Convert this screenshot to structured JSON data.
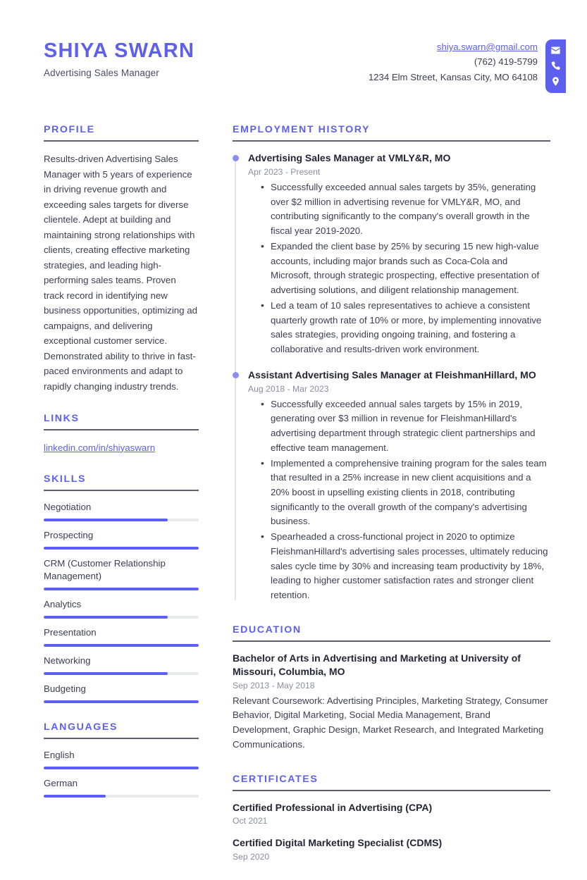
{
  "accent_color": "#5d5fef",
  "rule_color": "#5a6070",
  "header": {
    "full_name": "SHIYA SWARN",
    "job_title": "Advertising Sales Manager",
    "contact": {
      "email": "shiya.swarn@gmail.com",
      "phone": "(762) 419-5799",
      "address": "1234 Elm Street, Kansas City, MO 64108",
      "icons": [
        "envelope-icon",
        "phone-icon",
        "location-pin-icon"
      ]
    }
  },
  "profile": {
    "heading": "PROFILE",
    "text": "Results-driven Advertising Sales Manager with 5 years of experience in driving revenue growth and exceeding sales targets for diverse clientele. Adept at building and maintaining strong relationships with clients, creating effective marketing strategies, and leading high-performing sales teams. Proven track record in identifying new business opportunities, optimizing ad campaigns, and delivering exceptional customer service. Demonstrated ability to thrive in fast-paced environments and adapt to rapidly changing industry trends."
  },
  "links": {
    "heading": "LINKS",
    "items": [
      {
        "label": "linkedin.com/in/shiyaswarn"
      }
    ]
  },
  "skills": {
    "heading": "SKILLS",
    "items": [
      {
        "label": "Negotiation",
        "level": 80
      },
      {
        "label": "Prospecting",
        "level": 100
      },
      {
        "label": "CRM (Customer Relationship Management)",
        "level": 100
      },
      {
        "label": "Analytics",
        "level": 80
      },
      {
        "label": "Presentation",
        "level": 100
      },
      {
        "label": "Networking",
        "level": 80
      },
      {
        "label": "Budgeting",
        "level": 100
      }
    ]
  },
  "languages": {
    "heading": "LANGUAGES",
    "items": [
      {
        "label": "English",
        "level": 100
      },
      {
        "label": "German",
        "level": 40
      }
    ]
  },
  "employment": {
    "heading": "EMPLOYMENT HISTORY",
    "jobs": [
      {
        "title": "Advertising Sales Manager at VMLY&R, MO",
        "date": "Apr 2023 - Present",
        "bullets": [
          "Successfully exceeded annual sales targets by 35%, generating over $2 million in advertising revenue for VMLY&R, MO, and contributing significantly to the company's overall growth in the fiscal year 2019-2020.",
          "Expanded the client base by 25% by securing 15 new high-value accounts, including major brands such as Coca-Cola and Microsoft, through strategic prospecting, effective presentation of advertising solutions, and diligent relationship management.",
          "Led a team of 10 sales representatives to achieve a consistent quarterly growth rate of 10% or more, by implementing innovative sales strategies, providing ongoing training, and fostering a collaborative and results-driven work environment."
        ]
      },
      {
        "title": "Assistant Advertising Sales Manager at FleishmanHillard, MO",
        "date": "Aug 2018 - Mar 2023",
        "bullets": [
          "Successfully exceeded annual sales targets by 15% in 2019, generating over $3 million in revenue for FleishmanHillard's advertising department through strategic client partnerships and effective team management.",
          "Implemented a comprehensive training program for the sales team that resulted in a 25% increase in new client acquisitions and a 20% boost in upselling existing clients in 2018, contributing significantly to the overall growth of the company's advertising business.",
          "Spearheaded a cross-functional project in 2020 to optimize FleishmanHillard's advertising sales processes, ultimately reducing sales cycle time by 30% and increasing team productivity by 18%, leading to higher customer satisfaction rates and stronger client retention."
        ]
      }
    ]
  },
  "education": {
    "heading": "EDUCATION",
    "entries": [
      {
        "title": "Bachelor of Arts in Advertising and Marketing at University of Missouri, Columbia, MO",
        "date": "Sep 2013 - May 2018",
        "description": "Relevant Coursework: Advertising Principles, Marketing Strategy, Consumer Behavior, Digital Marketing, Social Media Management, Brand Development, Graphic Design, Market Research, and Integrated Marketing Communications."
      }
    ]
  },
  "certificates": {
    "heading": "CERTIFICATES",
    "entries": [
      {
        "title": "Certified Professional in Advertising (CPA)",
        "date": "Oct 2021"
      },
      {
        "title": "Certified Digital Marketing Specialist (CDMS)",
        "date": "Sep 2020"
      }
    ]
  }
}
